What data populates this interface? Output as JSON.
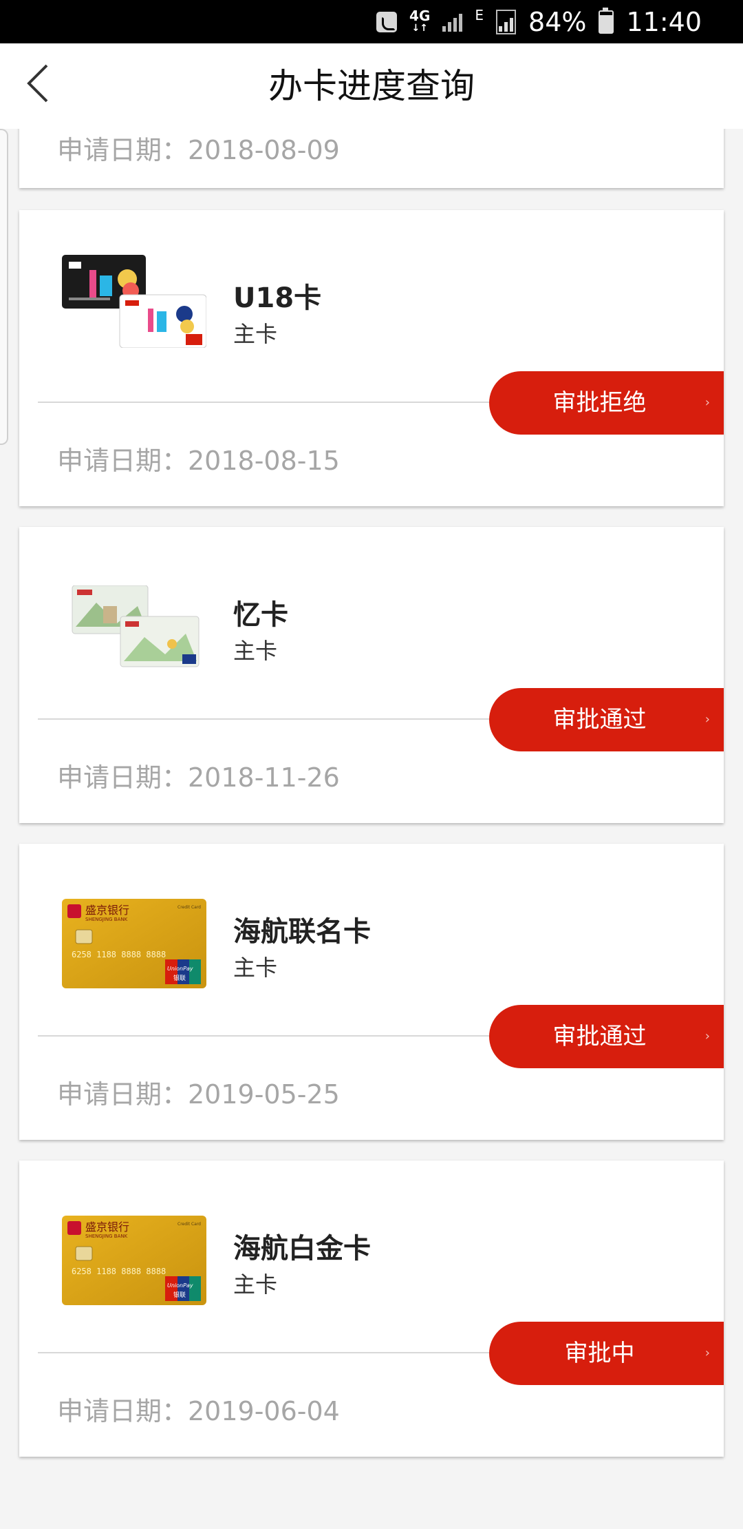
{
  "status_bar": {
    "network_top": "4G",
    "network_bottom": "↓↑",
    "network_type": "E",
    "battery": "84%",
    "time": "11:40",
    "icons": [
      "phone-icon",
      "signal-icon",
      "signal-icon",
      "battery-icon"
    ]
  },
  "header": {
    "title": "办卡进度查询",
    "back_icon": "chevron-left-icon"
  },
  "date_prefix": "申请日期：",
  "top_partial": {
    "date": "申请日期：2018-08-09"
  },
  "cards": [
    {
      "name": "U18卡",
      "sub": "主卡",
      "status": "审批拒绝",
      "date": "申请日期：2018-08-15",
      "image": "u18-card-thumbnail"
    },
    {
      "name": "忆卡",
      "sub": "主卡",
      "status": "审批通过",
      "date": "申请日期：2018-11-26",
      "image": "yi-card-thumbnail"
    },
    {
      "name": "海航联名卡",
      "sub": "主卡",
      "status": "审批通过",
      "date": "申请日期：2019-05-25",
      "image": "gold-card-thumbnail",
      "bank_name": "盛京银行",
      "bank_name_en": "SHENGJING BANK",
      "card_label": "Credit Card",
      "card_number": "6258 1188 8888 8888",
      "union_pay": "UnionPay",
      "union_pay_cn": "银联"
    },
    {
      "name": "海航白金卡",
      "sub": "主卡",
      "status": "审批中",
      "date": "申请日期：2019-06-04",
      "image": "gold-card-thumbnail",
      "bank_name": "盛京银行",
      "bank_name_en": "SHENGJING BANK",
      "card_label": "Credit Card",
      "card_number": "6258 1188 8888 8888",
      "union_pay": "UnionPay",
      "union_pay_cn": "银联"
    }
  ],
  "colors": {
    "accent": "#d71e0d",
    "background": "#f4f4f4",
    "date_text": "#a6a6a6"
  }
}
